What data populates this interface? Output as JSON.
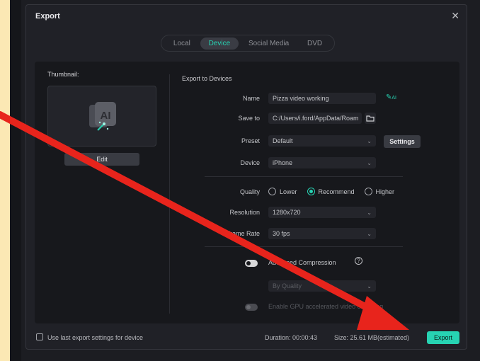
{
  "dialog": {
    "title": "Export",
    "tabs": [
      "Local",
      "Device",
      "Social Media",
      "DVD"
    ],
    "active_tab": "Device"
  },
  "thumbnail": {
    "label": "Thumbnail:",
    "edit_label": "Edit"
  },
  "export_to_devices": {
    "heading": "Export to Devices",
    "name_label": "Name",
    "name_value": "Pizza video working",
    "save_to_label": "Save to",
    "save_to_value": "C:/Users/i.ford/AppData/Roam",
    "preset_label": "Preset",
    "preset_value": "Default",
    "settings_label": "Settings",
    "device_label": "Device",
    "device_value": "iPhone",
    "quality_label": "Quality",
    "quality_options": [
      "Lower",
      "Recommend",
      "Higher"
    ],
    "quality_selected": "Recommend",
    "resolution_label": "Resolution",
    "resolution_value": "1280x720",
    "frame_rate_label": "Frame Rate",
    "frame_rate_value": "30 fps",
    "advanced_compression_label": "Advanced Compression",
    "by_quality_value": "By Quality",
    "gpu_label": "Enable GPU accelerated video encoding"
  },
  "footer": {
    "use_last_label": "Use last export settings for device",
    "duration": "Duration: 00:00:43",
    "size": "Size: 25.61 MB(estimated)",
    "export_label": "Export"
  },
  "colors": {
    "accent": "#27d3b3",
    "annotation_arrow": "#e8241c"
  }
}
